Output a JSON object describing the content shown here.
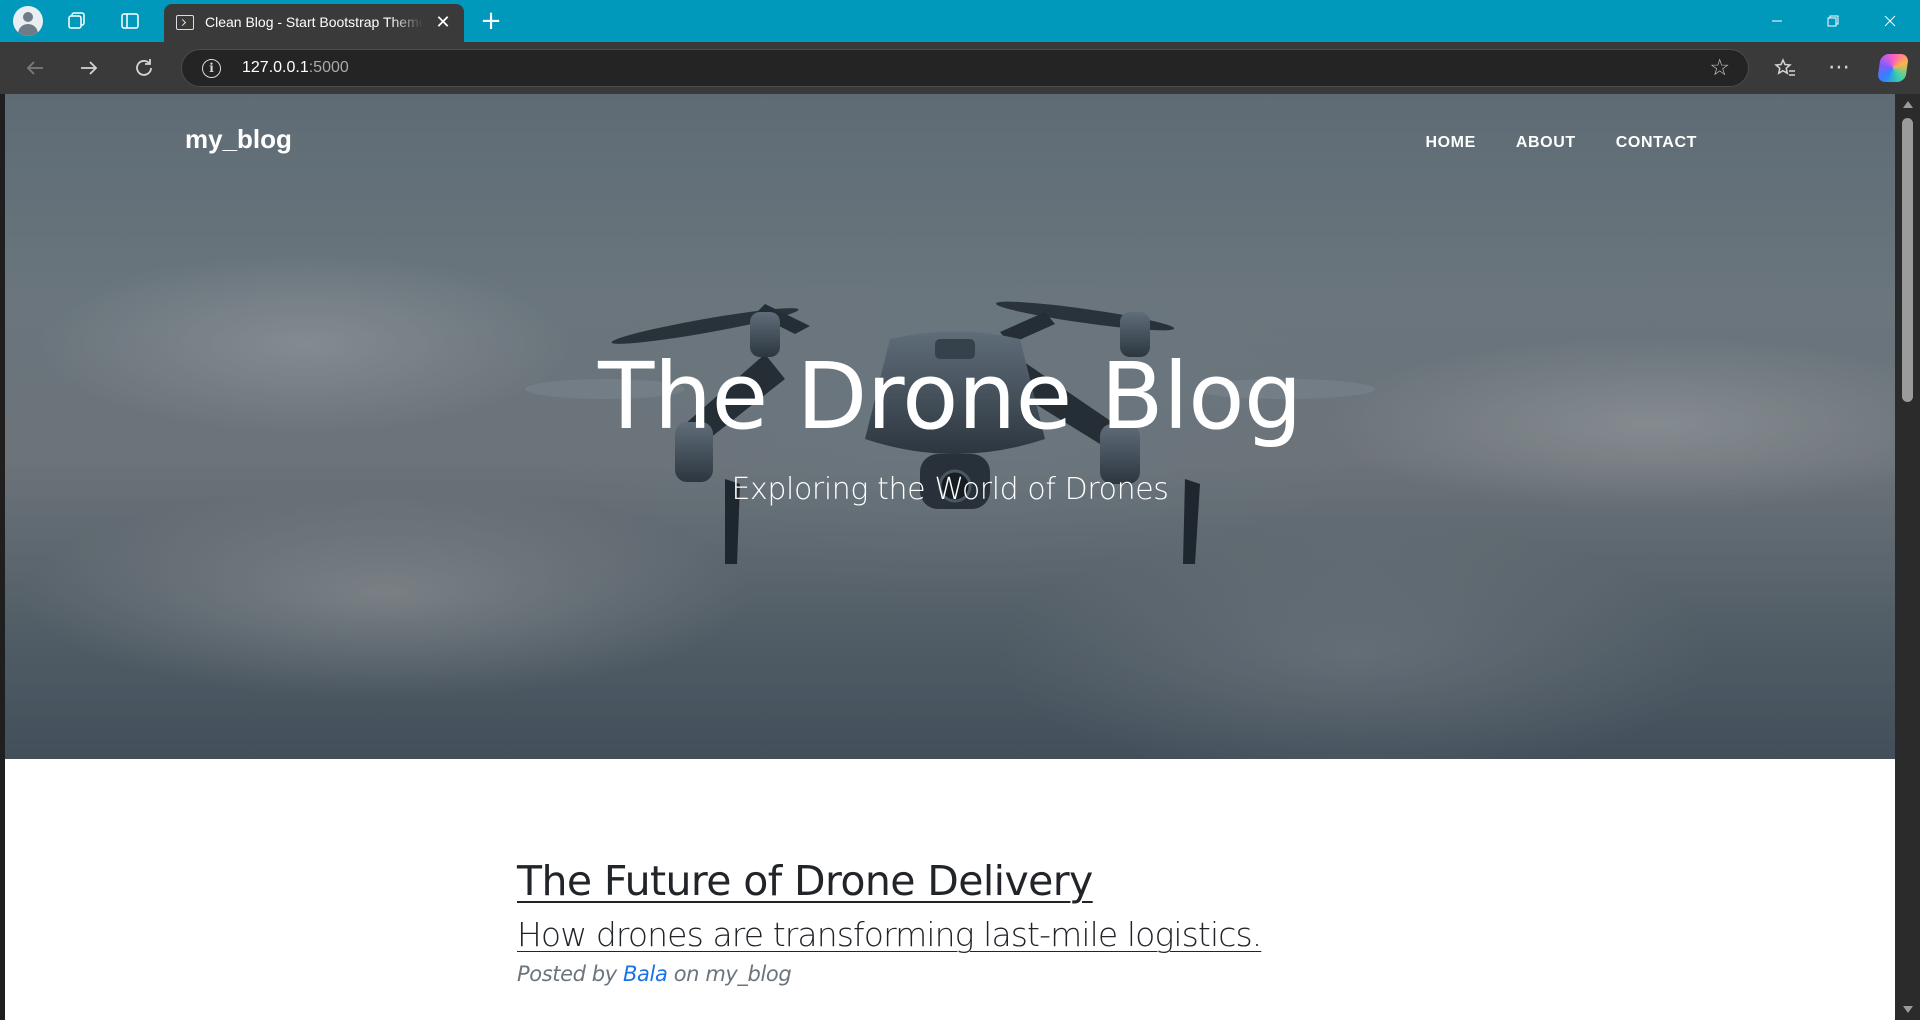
{
  "browser": {
    "tab": {
      "title": "Clean Blog - Start Bootstrap Theme"
    },
    "address_bar": {
      "host": "127.0.0.1",
      "port": ":5000"
    },
    "icons": [
      "profile-icon",
      "collections-icon",
      "tab-actions-icon",
      "new-tab-icon",
      "back-icon",
      "forward-icon",
      "refresh-icon",
      "info-icon",
      "favorite-star-icon",
      "favorites-icon",
      "more-icon",
      "copilot-icon"
    ],
    "accent_color": "#0099bc"
  },
  "site": {
    "brand": "my_blog",
    "nav": [
      {
        "label": "HOME"
      },
      {
        "label": "ABOUT"
      },
      {
        "label": "CONTACT"
      }
    ],
    "hero": {
      "title": "The Drone Blog",
      "subtitle": "Exploring the World of Drones"
    },
    "posts": [
      {
        "title": "The Future of Drone Delivery",
        "subtitle": "How drones are transforming last-mile logistics.",
        "meta_prefix": "Posted by ",
        "author": "Bala",
        "meta_suffix": " on my_blog"
      }
    ]
  }
}
